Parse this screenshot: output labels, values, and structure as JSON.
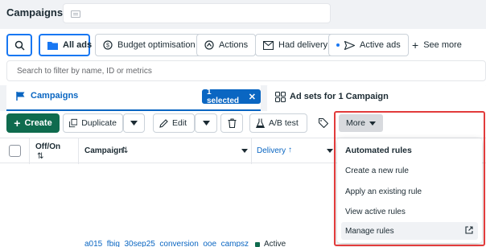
{
  "header": {
    "title": "Campaigns"
  },
  "filters": {
    "all_ads": "All ads",
    "budget": "Budget optimisation",
    "actions": "Actions",
    "had_delivery": "Had delivery",
    "active_ads": "Active ads",
    "see_more": "See more"
  },
  "search": {
    "placeholder": "Search to filter by name, ID or metrics"
  },
  "tabs": {
    "campaigns": "Campaigns",
    "selected_chip": "1 selected",
    "adsets": "Ad sets for 1 Campaign"
  },
  "toolbar": {
    "create": "Create",
    "duplicate": "Duplicate",
    "edit": "Edit",
    "ab_test": "A/B test",
    "more": "More"
  },
  "table": {
    "headers": {
      "off_on": "Off/On",
      "campaign": "Campaign",
      "delivery": "Delivery"
    },
    "row": {
      "name": "a015_fbig_30sep25_conversion_ooe_campsz",
      "status": "Active"
    }
  },
  "more_menu": {
    "title": "Automated rules",
    "items": [
      "Create a new rule",
      "Apply an existing rule",
      "View active rules",
      "Manage rules"
    ]
  },
  "colors": {
    "accent": "#0a66c2",
    "create_green": "#0f6b4e",
    "highlight_red": "#e23b3b"
  }
}
